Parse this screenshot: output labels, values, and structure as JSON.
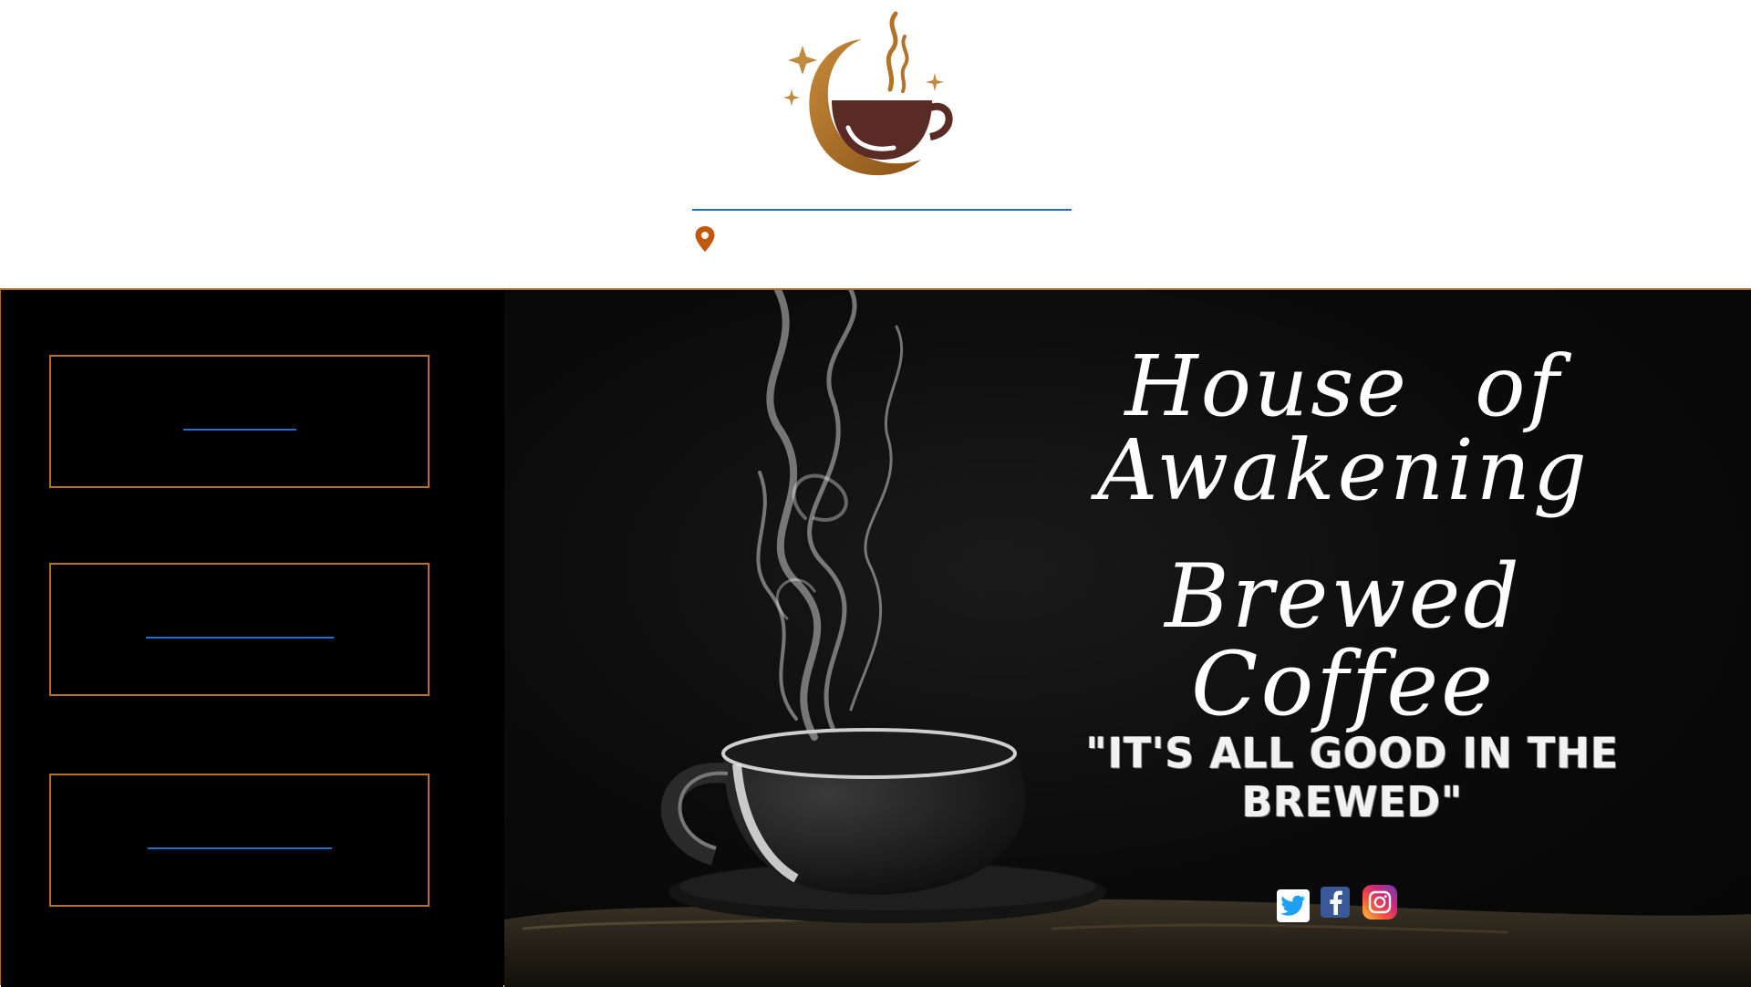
{
  "header": {
    "logo_icon": "crescent-moon-coffee-cup-logo",
    "location_icon": "map-pin-icon",
    "colors": {
      "logo_moon": "#b27327",
      "logo_cup": "#5a2a24",
      "link": "#1f6fd1",
      "pin": "#c2570e"
    }
  },
  "sidebar": {
    "items": [
      {
        "label": ""
      },
      {
        "label": ""
      },
      {
        "label": ""
      }
    ],
    "border_color": "#b27327"
  },
  "hero": {
    "title_line1": "House of Awakening",
    "title_line2": "Brewed Coffee",
    "tagline": "\"IT'S ALL GOOD IN THE BREWED\"",
    "social": [
      {
        "name": "twitter",
        "icon": "twitter-icon"
      },
      {
        "name": "facebook",
        "icon": "facebook-icon"
      },
      {
        "name": "instagram",
        "icon": "instagram-icon"
      }
    ]
  }
}
